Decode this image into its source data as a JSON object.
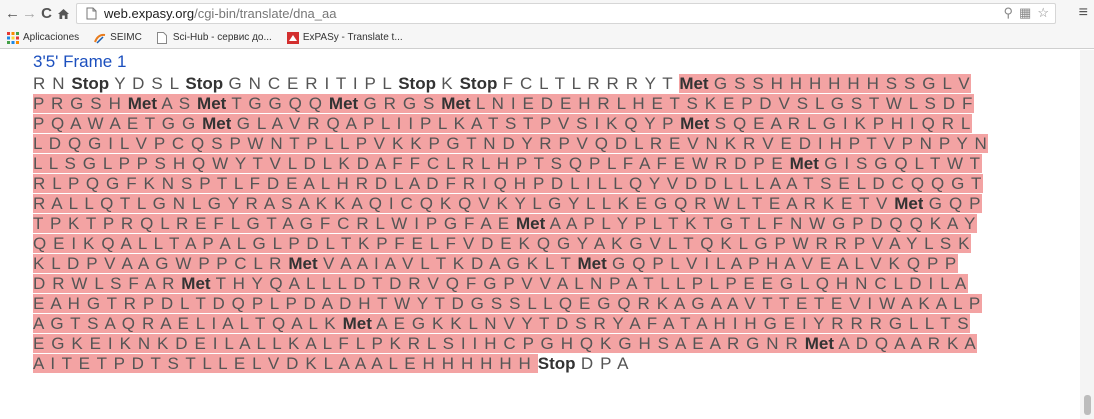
{
  "browser": {
    "url_host": "web.expasy.org",
    "url_path": "/cgi-bin/translate/dna_aa",
    "bookmarks": [
      {
        "label": "Aplicaciones",
        "icon": "apps-grid-icon"
      },
      {
        "label": "SEIMC",
        "icon": "seimc-logo-icon"
      },
      {
        "label": "Sci-Hub - сервис до...",
        "icon": "page-icon"
      },
      {
        "label": "ExPASy - Translate t...",
        "icon": "expasy-logo-icon"
      }
    ]
  },
  "frame_title": "3'5' Frame 1",
  "sequence_lines": [
    [
      [
        "n",
        "R N "
      ],
      [
        "k",
        "Stop"
      ],
      [
        "n",
        " Y D S L "
      ],
      [
        "k",
        "Stop"
      ],
      [
        "n",
        " G N C E R I T I P L "
      ],
      [
        "k",
        "Stop"
      ],
      [
        "n",
        " K "
      ],
      [
        "k",
        "Stop"
      ],
      [
        "n",
        " F C L T L R R R Y T "
      ],
      [
        "hk",
        "Met"
      ],
      [
        "h",
        " G S S H H H H H H S S G L V"
      ]
    ],
    [
      [
        "h",
        "P R G S H "
      ],
      [
        "hk",
        "Met"
      ],
      [
        "h",
        " A S "
      ],
      [
        "hk",
        "Met"
      ],
      [
        "h",
        " T G G Q Q "
      ],
      [
        "hk",
        "Met"
      ],
      [
        "h",
        " G R G S "
      ],
      [
        "hk",
        "Met"
      ],
      [
        "h",
        " L N I E D E H R L H E T S K E P D V S L G S T W L S D F"
      ]
    ],
    [
      [
        "h",
        "P Q A W A E T G G "
      ],
      [
        "hk",
        "Met"
      ],
      [
        "h",
        " G L A V R Q A P L I I P L K A T S T P V S I K Q Y P "
      ],
      [
        "hk",
        "Met"
      ],
      [
        "h",
        " S Q E A R L G I K P H I Q R L"
      ]
    ],
    [
      [
        "h",
        "L D Q G I L V P C Q S P W N T P L L P V K K P G T N D Y R P V Q D L R E V N K R V E D I H P T V P N P Y N"
      ]
    ],
    [
      [
        "h",
        "L L S G L P P S H Q W Y T V L D L K D A F F C L R L H P T S Q P L F A F E W R D P E "
      ],
      [
        "hk",
        "Met"
      ],
      [
        "h",
        " G I S G Q L T W T"
      ]
    ],
    [
      [
        "h",
        "R L P Q G F K N S P T L F D E A L H R D L A D F R I Q H P D L I L L Q Y V D D L L L A A T S E L D C Q Q G T"
      ]
    ],
    [
      [
        "h",
        "R A L L Q T L G N L G Y R A S A K K A Q I C Q K Q V K Y L G Y L L K E G Q R W L T E A R K E T V "
      ],
      [
        "hk",
        "Met"
      ],
      [
        "h",
        " G Q P"
      ]
    ],
    [
      [
        "h",
        "T P K T P R Q L R E F L G T A G F C R L W I P G F A E "
      ],
      [
        "hk",
        "Met"
      ],
      [
        "h",
        " A A P L Y P L T K T G T L F N W G P D Q Q K A Y"
      ]
    ],
    [
      [
        "h",
        "Q E I K Q A L L T A P A L G L P D L T K P F E L F V D E K Q G Y A K G V L T Q K L G P W R R P V A Y L S K"
      ]
    ],
    [
      [
        "h",
        "K L D P V A A G W P P C L R "
      ],
      [
        "hk",
        "Met"
      ],
      [
        "h",
        " V A A I A V L T K D A G K L T "
      ],
      [
        "hk",
        "Met"
      ],
      [
        "h",
        " G Q P L V I L A P H A V E A L V K Q P P"
      ]
    ],
    [
      [
        "h",
        "D R W L S F A R "
      ],
      [
        "hk",
        "Met"
      ],
      [
        "h",
        " T H Y Q A L L L D T D R V Q F G P V V A L N P A T L L P L P E E G L Q H N C L D I L A"
      ]
    ],
    [
      [
        "h",
        "E A H G T R P D L T D Q P L P D A D H T W Y T D G S S L L Q E G Q R K A G A A V T T E T E V I W A K A L P"
      ]
    ],
    [
      [
        "h",
        "A G T S A Q R A E L I A L T Q A L K "
      ],
      [
        "hk",
        "Met"
      ],
      [
        "h",
        " A E G K K L N V Y T D S R Y A F A T A H I H G E I Y R R R G L L T S"
      ]
    ],
    [
      [
        "h",
        "E G K E I K N K D E I L A L L K A L F L P K R L S I I H C P G H Q K G H S A E A R G N R "
      ],
      [
        "hk",
        "Met"
      ],
      [
        "h",
        " A D Q A A R K A"
      ]
    ],
    [
      [
        "h",
        "A I T E T P D T S T L L E L V D K L A A A L E H H H H H H "
      ],
      [
        "k",
        "Stop"
      ],
      [
        "n",
        " D P A"
      ]
    ]
  ]
}
